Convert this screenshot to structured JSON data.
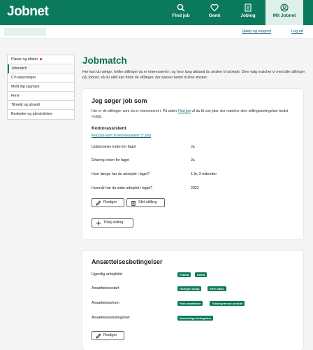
{
  "brand": {
    "logo_text": "Jobnet"
  },
  "nav": [
    {
      "label": "Find job",
      "icon": "search-icon"
    },
    {
      "label": "Gemt",
      "icon": "heart-icon"
    },
    {
      "label": "Joblog",
      "icon": "log-icon"
    },
    {
      "label": "Mit Jobnet",
      "icon": "user-icon"
    }
  ],
  "subbar": {
    "help": "Hjælp og support",
    "logout": "Log ud"
  },
  "sidebar": {
    "items": [
      {
        "label": "Planer og aftaler"
      },
      {
        "label": "Jobmatch"
      },
      {
        "label": "CV-oplysninger"
      },
      {
        "label": "Meld dig syg/rask"
      },
      {
        "label": "Ferie"
      },
      {
        "label": "Tilmeld og afmeld"
      },
      {
        "label": "Beskeder og påmindelser"
      }
    ]
  },
  "page": {
    "title": "Jobmatch",
    "intro": "Her kan du vælge, hvilke stillinger du er interesseret i, og hvor lang afstand du ønsker til arbejde. Dine valg matcher vi med alle stillinger på Jobnet, så du altid kan finde de stillinger, der passer bedst til dine ønsker."
  },
  "jobs_card": {
    "title": "Jeg søger job som",
    "desc_part1": "Her er de stillinger, som du er interesseret i. På siden ",
    "desc_link": "Find job",
    "desc_part2": " vil du få vist jobs, der matcher dine stillingsbetingelser bedst muligt.",
    "job_title": "Kontorassistent",
    "find_link": "Find job som 'Kontorassistent' (7 job)",
    "fields": [
      {
        "label": "Uddannelse inden for faget",
        "value": "Ja"
      },
      {
        "label": "Erfaring inden for faget",
        "value": "Ja"
      },
      {
        "label": "Hvor længe har du arbejdet i faget?",
        "value": "1 år, 3 måneder"
      },
      {
        "label": "Hvornår har du sidst arbejdet i faget?",
        "value": "2022"
      }
    ],
    "edit_button": "Rediger",
    "delete_button": "Slet stilling",
    "add_button": "Tilføj stilling"
  },
  "conditions_card": {
    "title": "Ansættelsesbetingelser",
    "rows": [
      {
        "label": "Ugentlig arbejdstid",
        "tags": [
          "Fuldtid",
          "Deltid"
        ]
      },
      {
        "label": "Ansættelsesstart",
        "tags": [
          "Hurtigst muligt",
          "Efter aftale"
        ]
      },
      {
        "label": "Ansættelsesform",
        "tags": [
          "Fast ansættelse",
          "Tidsbegrænset periode"
        ]
      },
      {
        "label": "Ansættelsesbetingelser",
        "tags": [
          "Almindelige betingelser"
        ]
      }
    ],
    "edit_button": "Rediger"
  },
  "colors": {
    "brand": "#0b7a5c",
    "link": "#0b6e7a",
    "alert": "#dd2222"
  }
}
